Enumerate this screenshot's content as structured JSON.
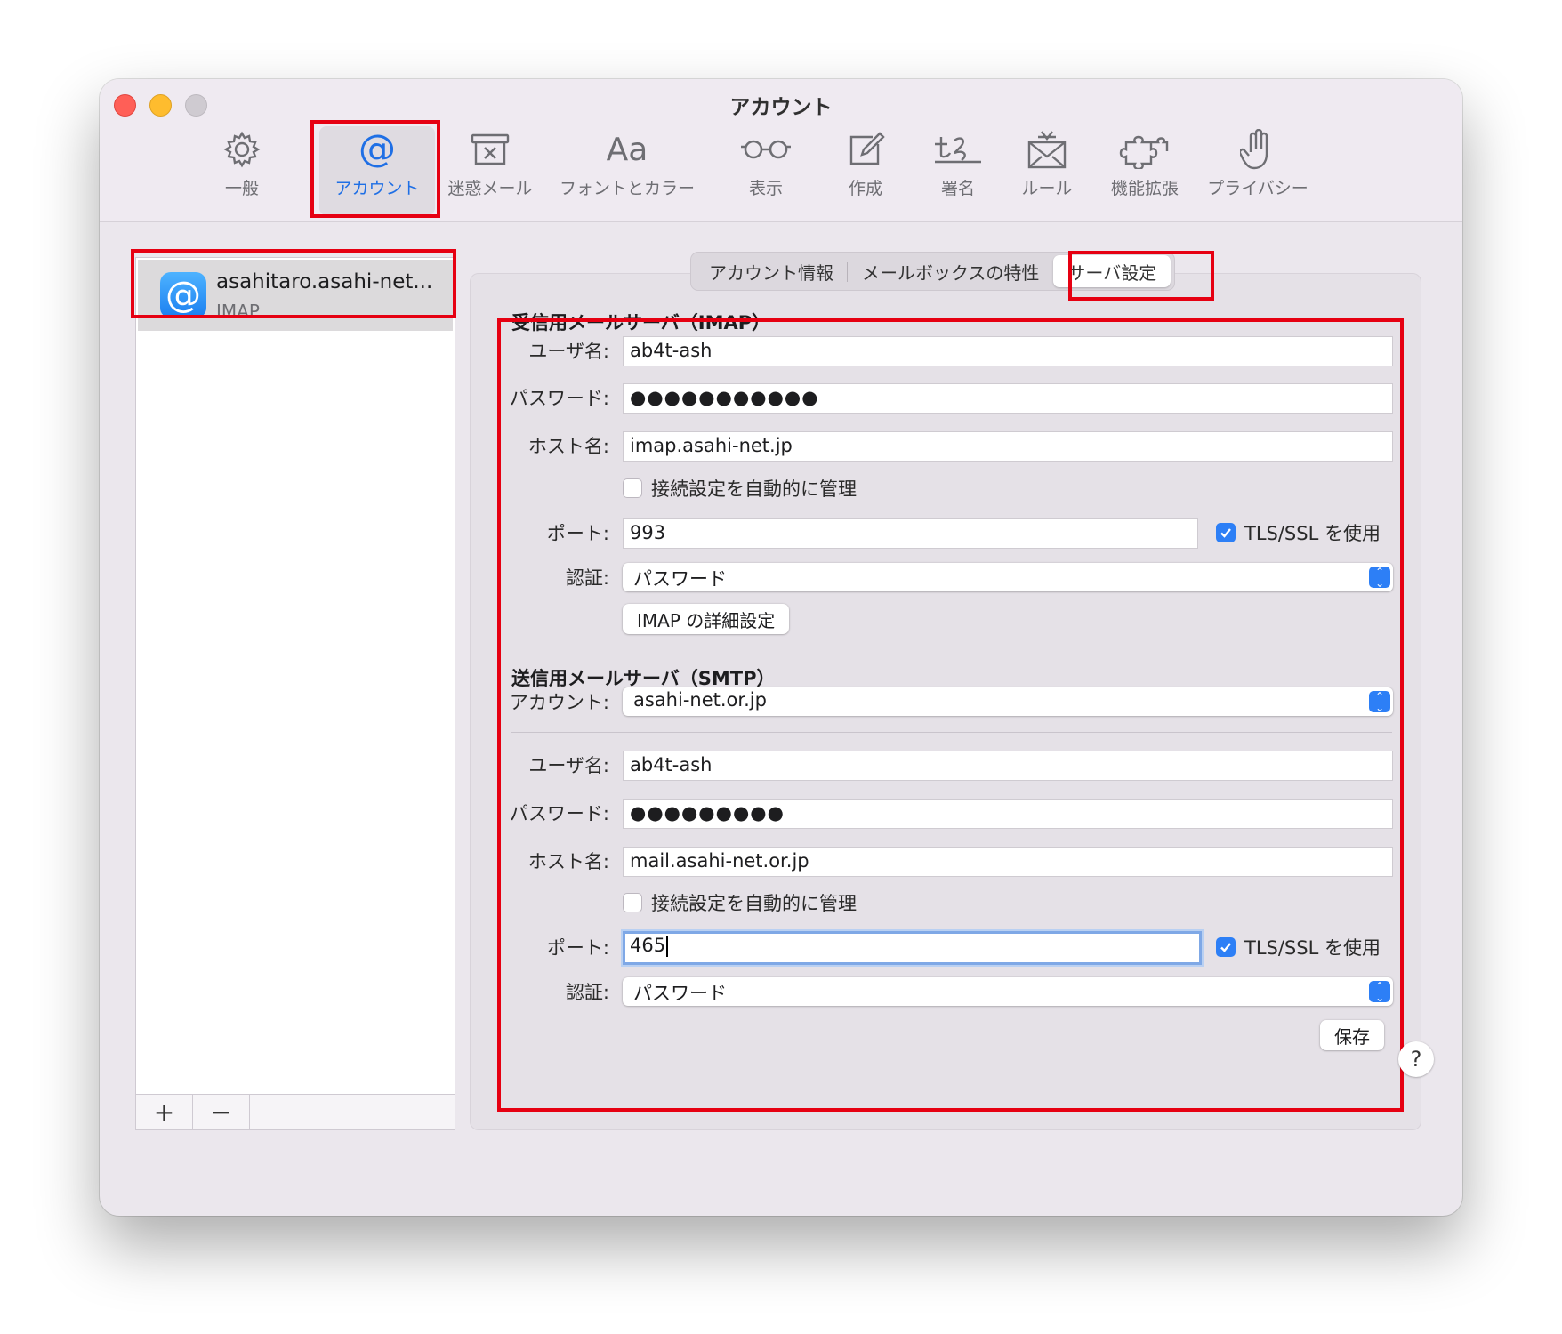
{
  "window": {
    "title": "アカウント"
  },
  "toolbar": [
    {
      "label": "一般",
      "icon": "gear-icon"
    },
    {
      "label": "アカウント",
      "icon": "at-sign-icon"
    },
    {
      "label": "迷惑メール",
      "icon": "junk-bin-icon"
    },
    {
      "label": "フォントとカラー",
      "icon": "font-aa-icon"
    },
    {
      "label": "表示",
      "icon": "glasses-icon"
    },
    {
      "label": "作成",
      "icon": "compose-icon"
    },
    {
      "label": "署名",
      "icon": "signature-icon"
    },
    {
      "label": "ルール",
      "icon": "rules-envelope-icon"
    },
    {
      "label": "機能拡張",
      "icon": "puzzle-icon"
    },
    {
      "label": "プライバシー",
      "icon": "hand-icon"
    }
  ],
  "sidebar": {
    "account": {
      "name": "asahitaro.asahi-net...",
      "type": "IMAP",
      "icon": "at-sign-icon"
    },
    "add_label": "+",
    "remove_label": "−"
  },
  "tabs": {
    "info": "アカウント情報",
    "mailbox": "メールボックスの特性",
    "server": "サーバ設定",
    "selected": "サーバ設定"
  },
  "incoming": {
    "title": "受信用メールサーバ（IMAP）",
    "username_label": "ユーザ名:",
    "username": "ab4t-ash",
    "password_label": "パスワード:",
    "password": "●●●●●●●●●●●",
    "host_label": "ホスト名:",
    "host": "imap.asahi-net.jp",
    "auto_label": "接続設定を自動的に管理",
    "auto_checked": false,
    "port_label": "ポート:",
    "port": "993",
    "tls_label": "TLS/SSL を使用",
    "tls_checked": true,
    "auth_label": "認証:",
    "auth": "パスワード",
    "advanced_button": "IMAP の詳細設定"
  },
  "outgoing": {
    "title": "送信用メールサーバ（SMTP）",
    "account_label": "アカウント:",
    "account": "asahi-net.or.jp",
    "username_label": "ユーザ名:",
    "username": "ab4t-ash",
    "password_label": "パスワード:",
    "password": "●●●●●●●●●",
    "host_label": "ホスト名:",
    "host": "mail.asahi-net.or.jp",
    "auto_label": "接続設定を自動的に管理",
    "auto_checked": false,
    "port_label": "ポート:",
    "port": "465",
    "tls_label": "TLS/SSL を使用",
    "tls_checked": true,
    "auth_label": "認証:",
    "auth": "パスワード"
  },
  "save_button": "保存",
  "help_label": "?",
  "colors": {
    "accent": "#2d7ff6",
    "highlight": "#e60012"
  }
}
